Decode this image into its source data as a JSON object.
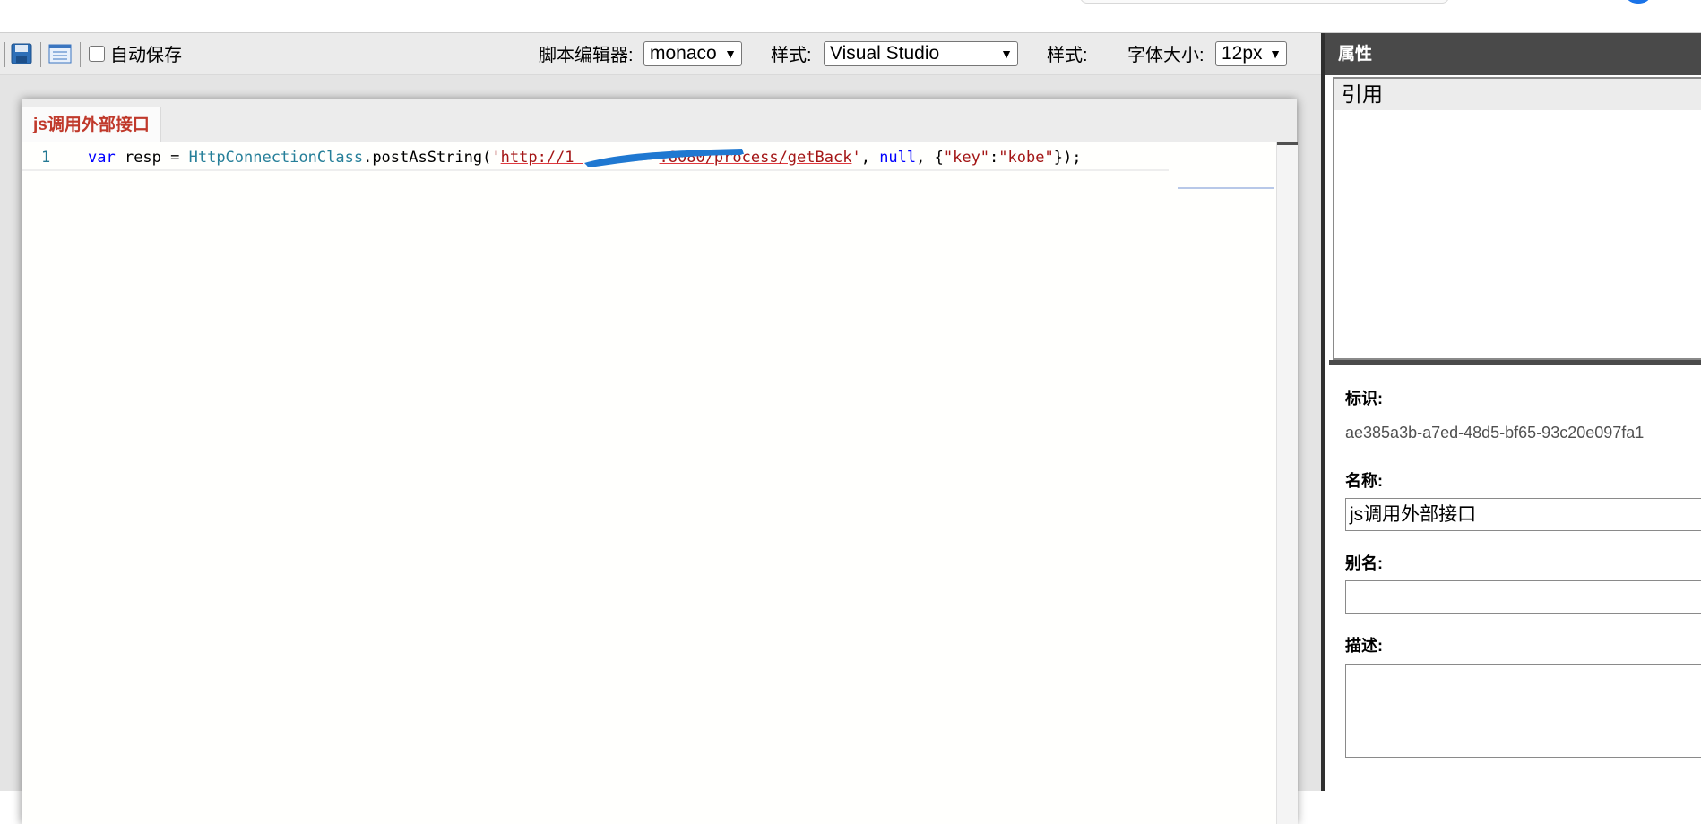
{
  "toolbar": {
    "autosave_label": "自动保存",
    "autosave_checked": false,
    "script_editor_label": "脚本编辑器:",
    "script_editor_value": "monaco",
    "style_label": "样式:",
    "style_value": "Visual Studio",
    "style2_label": "样式:",
    "font_size_label": "字体大小:",
    "font_size_value": "12px",
    "icons": [
      "save-icon",
      "list-window-icon"
    ]
  },
  "editor": {
    "tab_title": "js调用外部接口",
    "line_number": "1",
    "code": {
      "kw": "var",
      "ident": " resp = ",
      "cls": "HttpConnectionClass",
      "method": ".postAsString(",
      "quote_open": "'",
      "url_prefix": "http://1",
      "url_suffix": ":8080/process/getBack",
      "quote_close": "'",
      "comma1": ", ",
      "null_kw": "null",
      "obj_open": ", {",
      "key": "\"key\"",
      "colon": ":",
      "value": "\"kobe\"",
      "obj_close": "});"
    }
  },
  "properties": {
    "header": "属性",
    "references_title": "引用",
    "id_label": "标识:",
    "id_value": "ae385a3b-a7ed-48d5-bf65-93c20e097fa1",
    "name_label": "名称:",
    "name_value": "js调用外部接口",
    "alias_label": "别名:",
    "alias_value": "",
    "description_label": "描述:",
    "description_value": ""
  },
  "colors": {
    "keyword": "#0000ff",
    "class": "#267f99",
    "string": "#a31515",
    "tab_title": "#c0392b",
    "panel_header": "#494949",
    "redaction": "#1f78d1"
  }
}
